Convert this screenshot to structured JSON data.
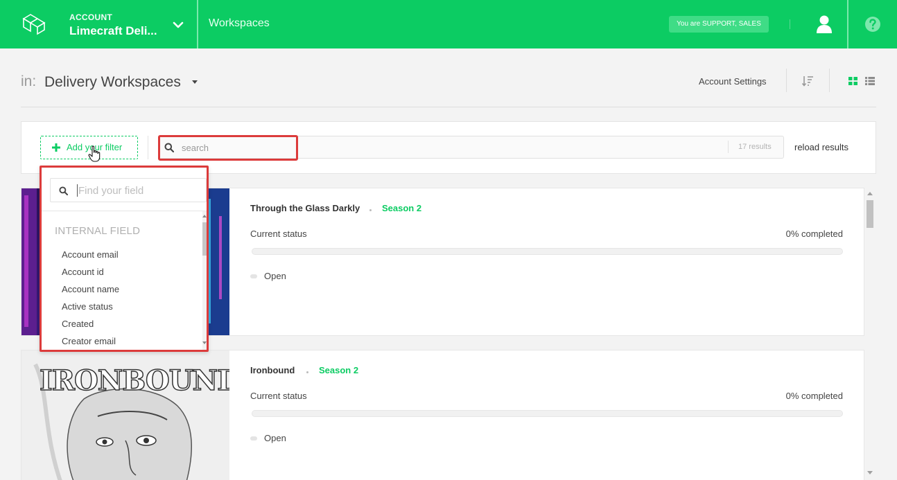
{
  "topbar": {
    "account_label": "ACCOUNT",
    "account_name": "Limecraft Deli...",
    "section_title": "Workspaces",
    "role_badge": "You are SUPPORT, SALES"
  },
  "header": {
    "in_label": "in:",
    "workspace_select": "Delivery Workspaces",
    "account_settings": "Account Settings"
  },
  "filter_bar": {
    "add_filter_label": "Add your filter",
    "search_placeholder": "search",
    "results_count": "17 results",
    "reload_label": "reload results"
  },
  "field_dropdown": {
    "search_placeholder": "Find your field",
    "group_label": "INTERNAL FIELD",
    "items": [
      "Account email",
      "Account id",
      "Account name",
      "Active status",
      "Created",
      "Creator email"
    ]
  },
  "cards": [
    {
      "title": "Through the Glass Darkly",
      "season": "Season 2",
      "status_label": "Current status",
      "completed": "0% completed",
      "progress": 0,
      "open_label": "Open"
    },
    {
      "title": "Ironbound",
      "season": "Season 2",
      "status_label": "Current status",
      "completed": "0% completed",
      "progress": 0,
      "open_label": "Open",
      "thumbnail_text": "IRONBOUND"
    }
  ],
  "colors": {
    "brand_green": "#0ccc63",
    "highlight_red": "#dc3b3b"
  },
  "icons": [
    "logo-icon",
    "chevron-down-icon",
    "user-icon",
    "help-icon",
    "sort-icon",
    "grid-view-icon",
    "list-view-icon",
    "plus-icon",
    "search-icon",
    "hand-cursor-icon"
  ]
}
